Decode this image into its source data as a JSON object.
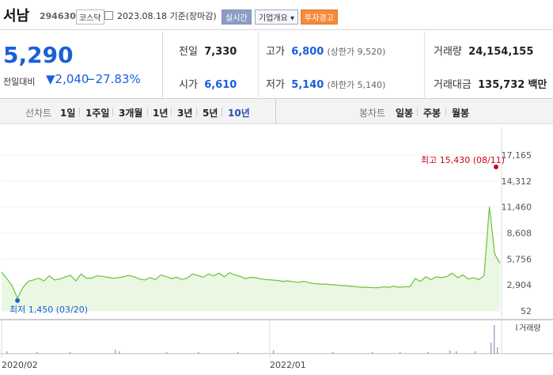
{
  "header": {
    "name": "서남",
    "code": "294630",
    "market": "코스닥",
    "date": "2023.08.18 기준(장마감)",
    "btn_realtime": "실시간",
    "btn_company": "기업개요 ▾",
    "btn_warning": "투자경고"
  },
  "summary": {
    "price": "5,290",
    "diff_label": "전일대비",
    "diff_value": "▼2,040",
    "diff_rate": "−27.83%",
    "prev_label": "전일",
    "prev_value": "7,330",
    "high_label": "고가",
    "high_value": "6,800",
    "high_limit": "(상한가 9,520)",
    "volume_label": "거래량",
    "volume_value": "24,154,155",
    "open_label": "시가",
    "open_value": "6,610",
    "low_label": "저가",
    "low_value": "5,140",
    "low_limit": "(하한가 5,140)",
    "amount_label": "거래대금",
    "amount_value": "135,732",
    "amount_unit": "백만"
  },
  "tabs": {
    "line_chart": "선차트",
    "periods": [
      "1일",
      "1주일",
      "3개월",
      "1년",
      "3년",
      "5년",
      "10년"
    ],
    "candle_chart": "봉차트",
    "candles": [
      "일봉",
      "주봉",
      "월봉"
    ]
  },
  "colors": {
    "up": "#d0021b",
    "down": "#1a5fdb",
    "line": "#6cc13a",
    "fill": "#eaf7e2"
  },
  "chart_data": {
    "type": "area",
    "yticks": [
      "17,165",
      "14,312",
      "11,460",
      "8,608",
      "5,756",
      "2,904",
      "52"
    ],
    "xticks": [
      "2020/02",
      "2022/01"
    ],
    "annotations": {
      "high": "최고 15,430 (08/11)",
      "low": "최저 1,450 (03/20)"
    },
    "volume_label": "거래량",
    "ylim": [
      52,
      17165
    ],
    "series": [
      {
        "values": [
          4300,
          3600,
          2800,
          1450,
          2600,
          3300,
          3450,
          3650,
          3350,
          3900,
          3450,
          3550,
          3800,
          3950,
          3350,
          4100,
          3650,
          3650,
          3900,
          3850,
          3750,
          3650,
          3700,
          3800,
          3950,
          3800,
          3550,
          3450,
          3700,
          3500,
          4000,
          3850,
          3600,
          3750,
          3500,
          3650,
          4100,
          3950,
          3750,
          4100,
          3900,
          4200,
          3800,
          4250,
          4000,
          3850,
          3600,
          3750,
          3700,
          3550,
          3500,
          3450,
          3400,
          3300,
          3350,
          3250,
          3200,
          3300,
          3150,
          3050,
          3000,
          3000,
          2950,
          2900,
          2850,
          2800,
          2750,
          2700,
          2650,
          2650,
          2600,
          2600,
          2700,
          2650,
          2750,
          2650,
          2700,
          2700,
          3600,
          3300,
          3800,
          3500,
          3800,
          3700,
          3850,
          4200,
          3700,
          4000,
          3550,
          3700,
          3500,
          3900,
          11500,
          6300,
          5290
        ]
      }
    ]
  }
}
